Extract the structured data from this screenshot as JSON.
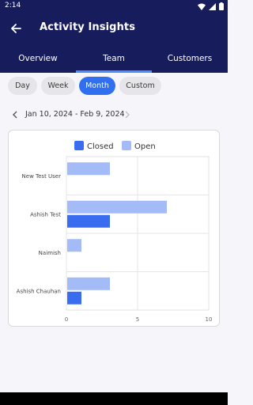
{
  "status": {
    "time": "2:14"
  },
  "header": {
    "title": "Activity Insights"
  },
  "tabs": [
    {
      "label": "Overview"
    },
    {
      "label": "Team"
    },
    {
      "label": "Customers"
    }
  ],
  "periods": [
    {
      "label": "Day"
    },
    {
      "label": "Week"
    },
    {
      "label": "Month"
    },
    {
      "label": "Custom"
    }
  ],
  "date_range": "Jan 10, 2024 - Feb 9, 2024",
  "colors": {
    "closed": "#3a6cf0",
    "open": "#a3bcf7",
    "appbar": "#171c5c",
    "active_tab_indicator": "#4d8dff"
  },
  "chart_data": {
    "type": "bar",
    "orientation": "horizontal",
    "categories": [
      "New Test User",
      "Ashish Test",
      "Naimish",
      "Ashish Chauhan"
    ],
    "series": [
      {
        "name": "Closed",
        "values": [
          0,
          3,
          0,
          1
        ]
      },
      {
        "name": "Open",
        "values": [
          3,
          7,
          1,
          3
        ]
      }
    ],
    "xlim": [
      0,
      10
    ],
    "xticks": [
      "0",
      "5",
      "10"
    ],
    "legend": "top-center",
    "grid": true
  }
}
